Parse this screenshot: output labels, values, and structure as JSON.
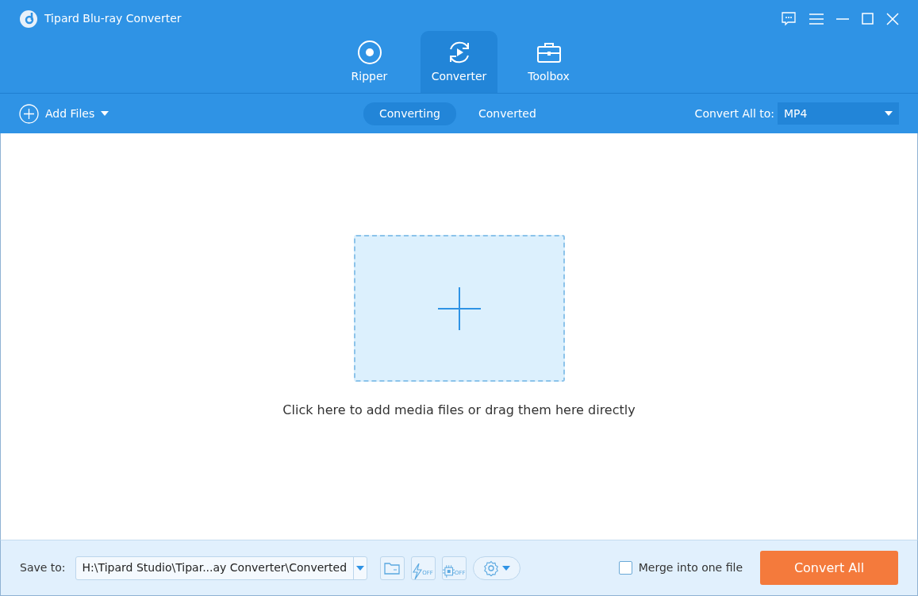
{
  "window": {
    "title": "Tipard Blu-ray Converter"
  },
  "modes": [
    {
      "kind": "ripper",
      "label": "Ripper",
      "selected": false
    },
    {
      "kind": "converter",
      "label": "Converter",
      "selected": true
    },
    {
      "kind": "toolbox",
      "label": "Toolbox",
      "selected": false
    }
  ],
  "toolbar": {
    "add_files": "Add Files",
    "tabs": [
      {
        "label": "Converting",
        "selected": true
      },
      {
        "label": "Converted",
        "selected": false
      }
    ],
    "convert_all_label": "Convert All to:",
    "format": "MP4"
  },
  "drop_area": {
    "hint": "Click here to add media files or drag them here directly"
  },
  "footer": {
    "save_to_label": "Save to:",
    "path": "H:\\Tipard Studio\\Tipar...ay Converter\\Converted",
    "acceleration": "OFF",
    "cpu": "OFF",
    "merge": {
      "label": "Merge into one file",
      "checked": false
    },
    "convert_button": "Convert All"
  }
}
